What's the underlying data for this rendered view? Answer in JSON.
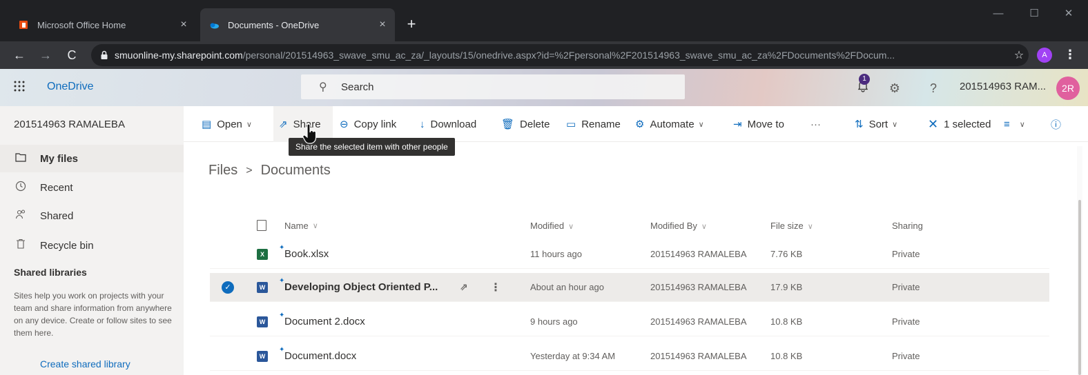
{
  "browser": {
    "tabs": [
      {
        "title": "Microsoft Office Home",
        "active": false
      },
      {
        "title": "Documents - OneDrive",
        "active": true
      }
    ],
    "new_tab": "+",
    "url_host": "smuonline-my.sharepoint.com",
    "url_path": "/personal/201514963_swave_smu_ac_za/_layouts/15/onedrive.aspx?id=%2Fpersonal%2F201514963_swave_smu_ac_za%2FDocuments%2FDocum...",
    "profile_initial": "A"
  },
  "suite": {
    "app_name": "OneDrive",
    "search_placeholder": "Search",
    "notification_count": "1",
    "user_name": "201514963 RAM...",
    "user_initials": "2R"
  },
  "leftnav": {
    "owner": "201514963 RAMALEBA",
    "items": [
      {
        "label": "My files",
        "icon": "folder-icon",
        "selected": true
      },
      {
        "label": "Recent",
        "icon": "clock-icon",
        "selected": false
      },
      {
        "label": "Shared",
        "icon": "people-icon",
        "selected": false
      },
      {
        "label": "Recycle bin",
        "icon": "trash-icon",
        "selected": false
      }
    ],
    "shared_libraries_title": "Shared libraries",
    "shared_libraries_desc": "Sites help you work on projects with your team and share information from anywhere on any device. Create or follow sites to see them here.",
    "create_library": "Create shared library"
  },
  "commands": {
    "open": "Open",
    "share": "Share",
    "copy_link": "Copy link",
    "download": "Download",
    "delete": "Delete",
    "rename": "Rename",
    "automate": "Automate",
    "move_to": "Move to",
    "more": "···",
    "sort": "Sort",
    "selected": "1 selected",
    "tooltip": "Share the selected item with other people"
  },
  "breadcrumb": {
    "root": "Files",
    "current": "Documents"
  },
  "table": {
    "headers": {
      "name": "Name",
      "modified": "Modified",
      "modified_by": "Modified By",
      "file_size": "File size",
      "sharing": "Sharing"
    },
    "rows": [
      {
        "name": "Book.xlsx",
        "type": "xlsx",
        "modified": "11 hours ago",
        "modified_by": "201514963 RAMALEBA",
        "size": "7.76 KB",
        "sharing": "Private",
        "selected": false
      },
      {
        "name": "Developing Object Oriented P...",
        "type": "docx",
        "modified": "About an hour ago",
        "modified_by": "201514963 RAMALEBA",
        "size": "17.9 KB",
        "sharing": "Private",
        "selected": true
      },
      {
        "name": "Document 2.docx",
        "type": "docx",
        "modified": "9 hours ago",
        "modified_by": "201514963 RAMALEBA",
        "size": "10.8 KB",
        "sharing": "Private",
        "selected": false
      },
      {
        "name": "Document.docx",
        "type": "docx",
        "modified": "Yesterday at 9:34 AM",
        "modified_by": "201514963 RAMALEBA",
        "size": "10.8 KB",
        "sharing": "Private",
        "selected": false
      }
    ]
  },
  "colors": {
    "accent": "#0f6cbd",
    "selected_row": "#edebe9",
    "nav_bg": "#f3f2f1"
  }
}
